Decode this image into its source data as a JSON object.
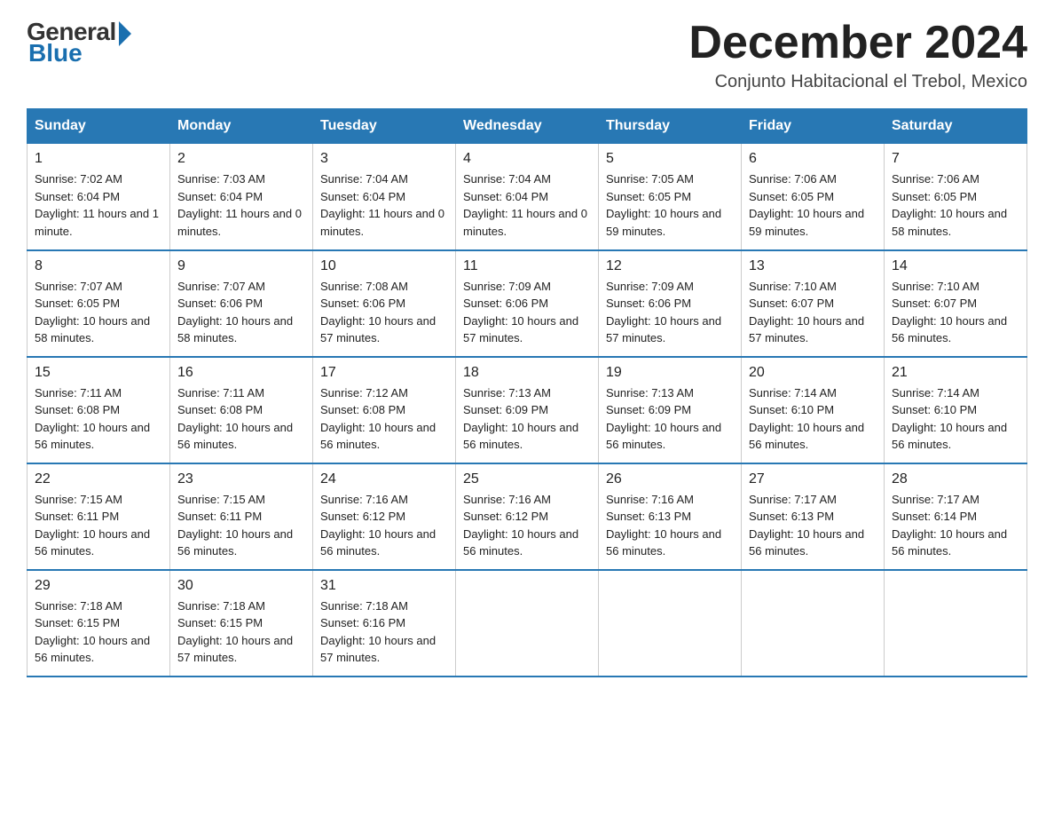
{
  "logo": {
    "general": "General",
    "blue": "Blue"
  },
  "title": {
    "month_year": "December 2024",
    "location": "Conjunto Habitacional el Trebol, Mexico"
  },
  "days_of_week": [
    "Sunday",
    "Monday",
    "Tuesday",
    "Wednesday",
    "Thursday",
    "Friday",
    "Saturday"
  ],
  "weeks": [
    [
      {
        "num": "1",
        "sunrise": "7:02 AM",
        "sunset": "6:04 PM",
        "daylight": "11 hours and 1 minute."
      },
      {
        "num": "2",
        "sunrise": "7:03 AM",
        "sunset": "6:04 PM",
        "daylight": "11 hours and 0 minutes."
      },
      {
        "num": "3",
        "sunrise": "7:04 AM",
        "sunset": "6:04 PM",
        "daylight": "11 hours and 0 minutes."
      },
      {
        "num": "4",
        "sunrise": "7:04 AM",
        "sunset": "6:04 PM",
        "daylight": "11 hours and 0 minutes."
      },
      {
        "num": "5",
        "sunrise": "7:05 AM",
        "sunset": "6:05 PM",
        "daylight": "10 hours and 59 minutes."
      },
      {
        "num": "6",
        "sunrise": "7:06 AM",
        "sunset": "6:05 PM",
        "daylight": "10 hours and 59 minutes."
      },
      {
        "num": "7",
        "sunrise": "7:06 AM",
        "sunset": "6:05 PM",
        "daylight": "10 hours and 58 minutes."
      }
    ],
    [
      {
        "num": "8",
        "sunrise": "7:07 AM",
        "sunset": "6:05 PM",
        "daylight": "10 hours and 58 minutes."
      },
      {
        "num": "9",
        "sunrise": "7:07 AM",
        "sunset": "6:06 PM",
        "daylight": "10 hours and 58 minutes."
      },
      {
        "num": "10",
        "sunrise": "7:08 AM",
        "sunset": "6:06 PM",
        "daylight": "10 hours and 57 minutes."
      },
      {
        "num": "11",
        "sunrise": "7:09 AM",
        "sunset": "6:06 PM",
        "daylight": "10 hours and 57 minutes."
      },
      {
        "num": "12",
        "sunrise": "7:09 AM",
        "sunset": "6:06 PM",
        "daylight": "10 hours and 57 minutes."
      },
      {
        "num": "13",
        "sunrise": "7:10 AM",
        "sunset": "6:07 PM",
        "daylight": "10 hours and 57 minutes."
      },
      {
        "num": "14",
        "sunrise": "7:10 AM",
        "sunset": "6:07 PM",
        "daylight": "10 hours and 56 minutes."
      }
    ],
    [
      {
        "num": "15",
        "sunrise": "7:11 AM",
        "sunset": "6:08 PM",
        "daylight": "10 hours and 56 minutes."
      },
      {
        "num": "16",
        "sunrise": "7:11 AM",
        "sunset": "6:08 PM",
        "daylight": "10 hours and 56 minutes."
      },
      {
        "num": "17",
        "sunrise": "7:12 AM",
        "sunset": "6:08 PM",
        "daylight": "10 hours and 56 minutes."
      },
      {
        "num": "18",
        "sunrise": "7:13 AM",
        "sunset": "6:09 PM",
        "daylight": "10 hours and 56 minutes."
      },
      {
        "num": "19",
        "sunrise": "7:13 AM",
        "sunset": "6:09 PM",
        "daylight": "10 hours and 56 minutes."
      },
      {
        "num": "20",
        "sunrise": "7:14 AM",
        "sunset": "6:10 PM",
        "daylight": "10 hours and 56 minutes."
      },
      {
        "num": "21",
        "sunrise": "7:14 AM",
        "sunset": "6:10 PM",
        "daylight": "10 hours and 56 minutes."
      }
    ],
    [
      {
        "num": "22",
        "sunrise": "7:15 AM",
        "sunset": "6:11 PM",
        "daylight": "10 hours and 56 minutes."
      },
      {
        "num": "23",
        "sunrise": "7:15 AM",
        "sunset": "6:11 PM",
        "daylight": "10 hours and 56 minutes."
      },
      {
        "num": "24",
        "sunrise": "7:16 AM",
        "sunset": "6:12 PM",
        "daylight": "10 hours and 56 minutes."
      },
      {
        "num": "25",
        "sunrise": "7:16 AM",
        "sunset": "6:12 PM",
        "daylight": "10 hours and 56 minutes."
      },
      {
        "num": "26",
        "sunrise": "7:16 AM",
        "sunset": "6:13 PM",
        "daylight": "10 hours and 56 minutes."
      },
      {
        "num": "27",
        "sunrise": "7:17 AM",
        "sunset": "6:13 PM",
        "daylight": "10 hours and 56 minutes."
      },
      {
        "num": "28",
        "sunrise": "7:17 AM",
        "sunset": "6:14 PM",
        "daylight": "10 hours and 56 minutes."
      }
    ],
    [
      {
        "num": "29",
        "sunrise": "7:18 AM",
        "sunset": "6:15 PM",
        "daylight": "10 hours and 56 minutes."
      },
      {
        "num": "30",
        "sunrise": "7:18 AM",
        "sunset": "6:15 PM",
        "daylight": "10 hours and 57 minutes."
      },
      {
        "num": "31",
        "sunrise": "7:18 AM",
        "sunset": "6:16 PM",
        "daylight": "10 hours and 57 minutes."
      },
      null,
      null,
      null,
      null
    ]
  ]
}
